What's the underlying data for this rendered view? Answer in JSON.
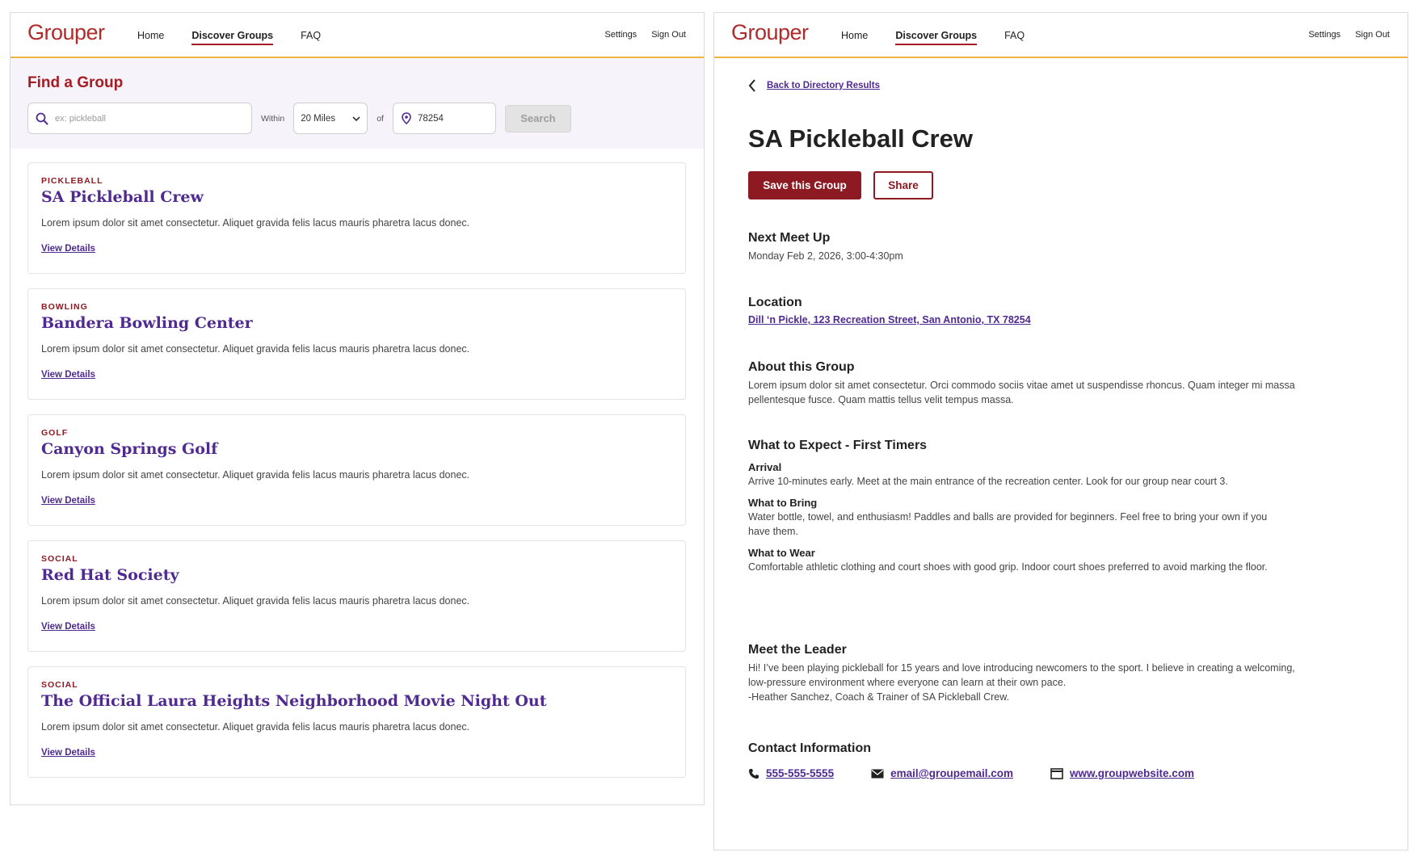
{
  "brand": {
    "logo": "Grouper",
    "accent": "#a51c24",
    "link_color": "#4f2a90",
    "rule_color": "#f0b443"
  },
  "nav": {
    "home": "Home",
    "discover": "Discover Groups",
    "faq": "FAQ",
    "settings": "Settings",
    "sign_out": "Sign Out"
  },
  "search": {
    "title": "Find a Group",
    "keyword_placeholder": "ex: pickleball",
    "within_label": "Within",
    "distance_value": "20 Miles",
    "of_label": "of",
    "zip_value": "78254",
    "button_label": "Search"
  },
  "results": [
    {
      "category": "PICKLEBALL",
      "name": "SA Pickleball Crew",
      "description": "Lorem ipsum dolor sit amet consectetur. Aliquet gravida felis lacus mauris pharetra lacus donec.",
      "link": "View Details"
    },
    {
      "category": "BOWLING",
      "name": "Bandera Bowling Center",
      "description": "Lorem ipsum dolor sit amet consectetur. Aliquet gravida felis lacus mauris pharetra lacus donec.",
      "link": "View Details"
    },
    {
      "category": "GOLF",
      "name": "Canyon Springs Golf",
      "description": "Lorem ipsum dolor sit amet consectetur. Aliquet gravida felis lacus mauris pharetra lacus donec.",
      "link": "View Details"
    },
    {
      "category": "SOCIAL",
      "name": "Red Hat Society",
      "description": "Lorem ipsum dolor sit amet consectetur. Aliquet gravida felis lacus mauris pharetra lacus donec.",
      "link": "View Details"
    },
    {
      "category": "SOCIAL",
      "name": "The Official Laura Heights Neighborhood Movie Night Out",
      "description": "Lorem ipsum dolor sit amet consectetur. Aliquet gravida felis lacus mauris pharetra lacus donec.",
      "link": "View Details"
    }
  ],
  "detail": {
    "back_label": "Back to Directory Results",
    "title": "SA Pickleball Crew",
    "save_label": "Save this Group",
    "share_label": "Share",
    "next_meetup": {
      "heading": "Next Meet Up",
      "text": "Monday Feb 2, 2026, 3:00-4:30pm"
    },
    "location": {
      "heading": "Location",
      "text": "Dill ‘n Pickle, 123 Recreation Street, San Antonio, TX 78254"
    },
    "about": {
      "heading": "About this Group",
      "text": "Lorem ipsum dolor sit amet consectetur. Orci commodo sociis vitae amet ut suspendisse rhoncus. Quam integer mi massa pellentesque fusce. Quam mattis tellus velit tempus massa."
    },
    "expect": {
      "heading": "What to Expect - First Timers",
      "arrival_h": "Arrival",
      "arrival_p": "Arrive 10-minutes early. Meet at the main entrance of the recreation center. Look for our group near court 3.",
      "bring_h": "What to Bring",
      "bring_p": "Water bottle, towel, and enthusiasm! Paddles and balls are provided for beginners. Feel free to bring your own if you have them.",
      "wear_h": "What to Wear",
      "wear_p": "Comfortable athletic clothing and court shoes with good grip. Indoor court shoes preferred to avoid marking the floor."
    },
    "leader": {
      "heading": "Meet the Leader",
      "text": "Hi! I’ve been playing pickleball for 15 years and love introducing newcomers to the sport. I believe in creating a welcoming, low-pressure environment where everyone can learn at their own pace.",
      "signature": "-Heather Sanchez, Coach & Trainer of SA Pickleball Crew."
    },
    "contact": {
      "heading": "Contact Information",
      "phone": "555-555-5555",
      "email": "email@groupemail.com",
      "website": "www.groupwebsite.com"
    }
  }
}
